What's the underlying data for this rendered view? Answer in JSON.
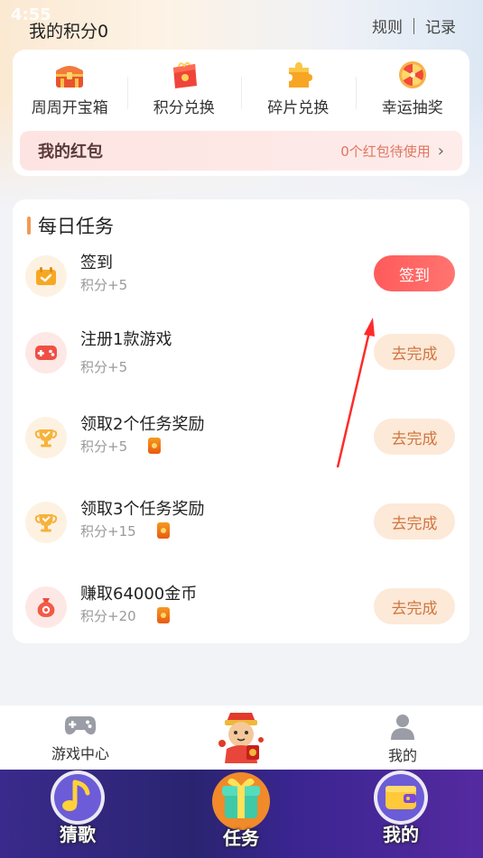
{
  "status": {
    "time": "4:55"
  },
  "header": {
    "points_title": "我的积分0",
    "rules_label": "规则",
    "records_label": "记录"
  },
  "exchange": {
    "items": [
      {
        "label": "周周开宝箱",
        "icon": "treasure-chest-icon"
      },
      {
        "label": "积分兑换",
        "icon": "gift-box-icon"
      },
      {
        "label": "碎片兑换",
        "icon": "puzzle-piece-icon"
      },
      {
        "label": "幸运抽奖",
        "icon": "lucky-wheel-icon"
      }
    ]
  },
  "redpacket": {
    "title": "我的红包",
    "status": "0个红包待使用"
  },
  "tasks": {
    "title": "每日任务",
    "items": [
      {
        "name": "签到",
        "points": "积分+5",
        "button": "签到",
        "icon": "calendar-check-icon",
        "has_badge": false,
        "primary": true
      },
      {
        "name": "注册1款游戏",
        "points": "积分+5",
        "button": "去完成",
        "icon": "gamepad-icon",
        "has_badge": false,
        "primary": false
      },
      {
        "name": "领取2个任务奖励",
        "points": "积分+5",
        "button": "去完成",
        "icon": "trophy-icon",
        "has_badge": true,
        "primary": false
      },
      {
        "name": "领取3个任务奖励",
        "points": "积分+15",
        "button": "去完成",
        "icon": "trophy-icon",
        "has_badge": true,
        "primary": false
      },
      {
        "name": "赚取64000金币",
        "points": "积分+20",
        "button": "去完成",
        "icon": "money-bag-icon",
        "has_badge": true,
        "primary": false
      }
    ]
  },
  "bottom_nav": {
    "items": [
      {
        "label": "游戏中心",
        "icon": "gamepad-icon"
      },
      {
        "label": "",
        "icon": "mascot-icon"
      },
      {
        "label": "我的",
        "icon": "user-icon"
      }
    ]
  },
  "tabbar": {
    "items": [
      {
        "label": "猜歌",
        "icon": "music-note-icon"
      },
      {
        "label": "任务",
        "icon": "gift-icon"
      },
      {
        "label": "我的",
        "icon": "wallet-icon"
      }
    ]
  },
  "colors": {
    "accent_red": "#ff5b5b",
    "accent_orange": "#f09a57",
    "secondary_button_bg": "#fde9d8",
    "tabbar_bg": "#2a2470"
  }
}
